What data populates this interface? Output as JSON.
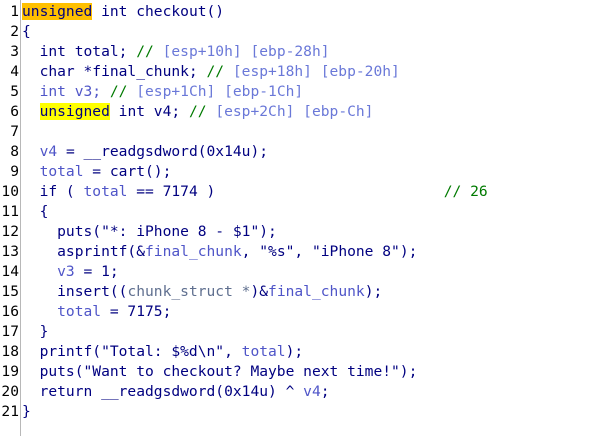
{
  "lines": [
    {
      "n": "1",
      "t": [
        {
          "c": "cursor-hl",
          "s": "unsigned"
        },
        {
          "c": "kw",
          "s": " int checkout()"
        }
      ]
    },
    {
      "n": "2",
      "t": [
        {
          "c": "kw",
          "s": "{"
        }
      ]
    },
    {
      "n": "3",
      "t": [
        {
          "c": "kw",
          "s": "  int total; "
        },
        {
          "c": "cm",
          "s": "// "
        },
        {
          "c": "cmv",
          "s": "[esp+10h] [ebp-28h]"
        }
      ]
    },
    {
      "n": "4",
      "t": [
        {
          "c": "kw",
          "s": "  char *final_chunk; "
        },
        {
          "c": "cm",
          "s": "// "
        },
        {
          "c": "cmv",
          "s": "[esp+18h] [ebp-20h]"
        }
      ]
    },
    {
      "n": "5",
      "t": [
        {
          "c": "var",
          "s": "  int v3; "
        },
        {
          "c": "cm",
          "s": "// "
        },
        {
          "c": "cmv",
          "s": "[esp+1Ch] [ebp-1Ch]"
        }
      ]
    },
    {
      "n": "6",
      "t": [
        {
          "c": "kw",
          "s": "  "
        },
        {
          "c": "hl",
          "s": "unsigned"
        },
        {
          "c": "kw",
          "s": " int v4; "
        },
        {
          "c": "cm",
          "s": "// "
        },
        {
          "c": "cmv",
          "s": "[esp+2Ch] [ebp-Ch]"
        }
      ]
    },
    {
      "n": "7",
      "t": [
        {
          "c": "kw",
          "s": ""
        }
      ]
    },
    {
      "n": "8",
      "t": [
        {
          "c": "var",
          "s": "  v4"
        },
        {
          "c": "kw",
          "s": " = __readgsdword(0x14u);"
        }
      ]
    },
    {
      "n": "9",
      "t": [
        {
          "c": "var",
          "s": "  total"
        },
        {
          "c": "kw",
          "s": " = cart();"
        }
      ]
    },
    {
      "n": "10",
      "t": [
        {
          "c": "kw",
          "s": "  if ( "
        },
        {
          "c": "var",
          "s": "total"
        },
        {
          "c": "kw",
          "s": " == 7174 )                          "
        },
        {
          "c": "cm",
          "s": "// 26"
        }
      ]
    },
    {
      "n": "11",
      "t": [
        {
          "c": "kw",
          "s": "  {"
        }
      ]
    },
    {
      "n": "12",
      "t": [
        {
          "c": "kw",
          "s": "    puts(\"*: iPhone 8 - $1\");"
        }
      ]
    },
    {
      "n": "13",
      "t": [
        {
          "c": "kw",
          "s": "    asprintf(&"
        },
        {
          "c": "var",
          "s": "final_chunk"
        },
        {
          "c": "kw",
          "s": ", \"%s\", \"iPhone 8\");"
        }
      ]
    },
    {
      "n": "14",
      "t": [
        {
          "c": "var",
          "s": "    v3"
        },
        {
          "c": "kw",
          "s": " = 1;"
        }
      ]
    },
    {
      "n": "15",
      "t": [
        {
          "c": "kw",
          "s": "    insert(("
        },
        {
          "c": "cmr",
          "s": "chunk_struct *"
        },
        {
          "c": "kw",
          "s": ")&"
        },
        {
          "c": "var",
          "s": "final_chunk"
        },
        {
          "c": "kw",
          "s": ");"
        }
      ]
    },
    {
      "n": "16",
      "t": [
        {
          "c": "var",
          "s": "    total"
        },
        {
          "c": "kw",
          "s": " = 7175;"
        }
      ]
    },
    {
      "n": "17",
      "t": [
        {
          "c": "kw",
          "s": "  }"
        }
      ]
    },
    {
      "n": "18",
      "t": [
        {
          "c": "kw",
          "s": "  printf(\"Total: $%d\\n\", "
        },
        {
          "c": "var",
          "s": "total"
        },
        {
          "c": "kw",
          "s": ");"
        }
      ]
    },
    {
      "n": "19",
      "t": [
        {
          "c": "kw",
          "s": "  puts(\"Want to checkout? Maybe next time!\");"
        }
      ]
    },
    {
      "n": "20",
      "t": [
        {
          "c": "kw",
          "s": "  return __readgsdword(0x14u) ^ "
        },
        {
          "c": "var",
          "s": "v4"
        },
        {
          "c": "kw",
          "s": ";"
        }
      ]
    },
    {
      "n": "21",
      "t": [
        {
          "c": "kw",
          "s": "}"
        }
      ]
    }
  ]
}
